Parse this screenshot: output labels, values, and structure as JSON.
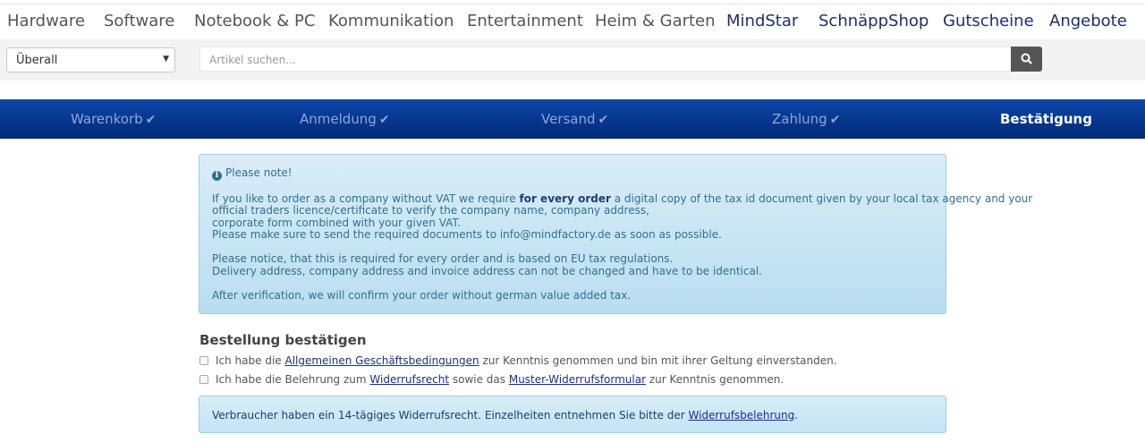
{
  "nav": {
    "items": [
      "Hardware",
      "Software",
      "Notebook & PC",
      "Kommunikation",
      "Entertainment",
      "Heim & Garten",
      "MindStar",
      "SchnäppShop",
      "Gutscheine",
      "Angebote"
    ]
  },
  "search": {
    "category": "Überall",
    "placeholder": "Artikel suchen..."
  },
  "steps": [
    "Warenkorb",
    "Anmeldung",
    "Versand",
    "Zahlung",
    "Bestätigung"
  ],
  "notice": {
    "title": "Please note!",
    "p1_pre": "If you like to order as a company without VAT we require ",
    "p1_bold": "for every order",
    "p1_post": " a digital copy of the tax id document given by your local tax agency and your",
    "p1_line2": "official traders licence/certificate to verify the company name, company address,",
    "p1_line3": "corporate form combined with your given VAT.",
    "p1_line4": "Please make sure to send the required documents to info@mindfactory.de as soon as possible.",
    "p2_line1": "Please notice, that this is required for every order and is based on EU tax regulations.",
    "p2_line2": "Delivery address, company address and invoice address can not be changed and have to be identical.",
    "p3": "After verification, we will confirm your order without german value added tax."
  },
  "confirm": {
    "title": "Bestellung bestätigen",
    "cb1_pre": "Ich habe die ",
    "cb1_link": "Allgemeinen Geschäftsbedingungen",
    "cb1_post": " zur Kenntnis genommen und bin mit ihrer Geltung einverstanden.",
    "cb2_pre": "Ich habe die Belehrung zum ",
    "cb2_link1": "Widerrufsrecht",
    "cb2_mid": " sowie das ",
    "cb2_link2": "Muster-Widerrufsformular",
    "cb2_post": " zur Kenntnis genommen."
  },
  "bottom_notice": {
    "pre": "Verbraucher haben ein 14-tägiges Widerrufsrecht. Einzelheiten entnehmen Sie bitte der ",
    "link": "Widerrufsbelehrung",
    "post": "."
  }
}
